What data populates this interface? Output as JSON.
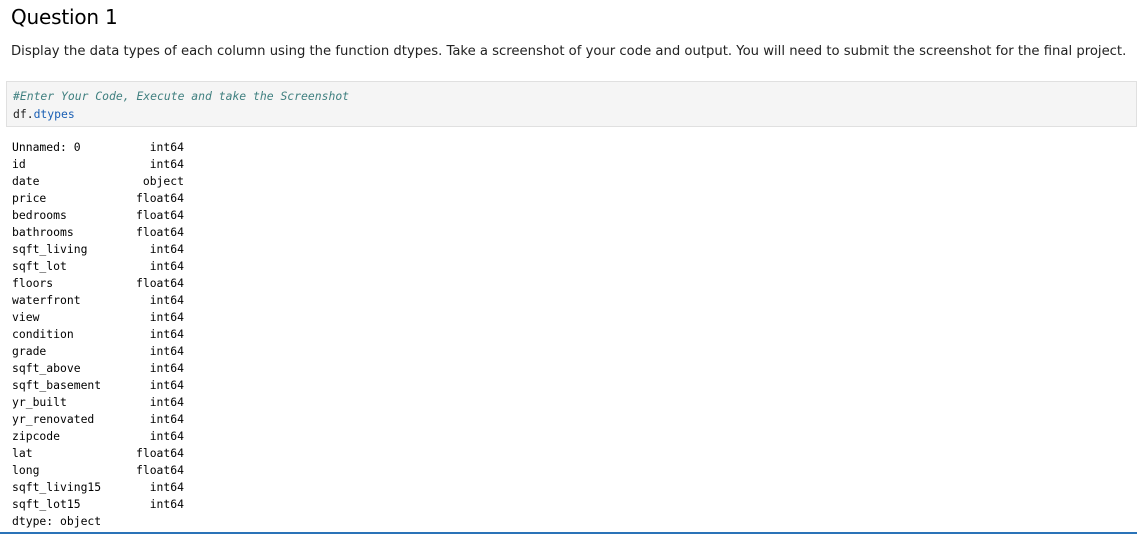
{
  "question": {
    "title": "Question 1",
    "description": "Display the data types of each column using the function dtypes. Take a screenshot of your code and output. You will need to submit the screenshot for the final project."
  },
  "code_cell": {
    "comment": "#Enter Your Code, Execute and take the Screenshot",
    "code_obj": "df.",
    "code_attr": "dtypes"
  },
  "output": {
    "rows": [
      {
        "name": "Unnamed: 0",
        "type": "int64"
      },
      {
        "name": "id",
        "type": "int64"
      },
      {
        "name": "date",
        "type": "object"
      },
      {
        "name": "price",
        "type": "float64"
      },
      {
        "name": "bedrooms",
        "type": "float64"
      },
      {
        "name": "bathrooms",
        "type": "float64"
      },
      {
        "name": "sqft_living",
        "type": "int64"
      },
      {
        "name": "sqft_lot",
        "type": "int64"
      },
      {
        "name": "floors",
        "type": "float64"
      },
      {
        "name": "waterfront",
        "type": "int64"
      },
      {
        "name": "view",
        "type": "int64"
      },
      {
        "name": "condition",
        "type": "int64"
      },
      {
        "name": "grade",
        "type": "int64"
      },
      {
        "name": "sqft_above",
        "type": "int64"
      },
      {
        "name": "sqft_basement",
        "type": "int64"
      },
      {
        "name": "yr_built",
        "type": "int64"
      },
      {
        "name": "yr_renovated",
        "type": "int64"
      },
      {
        "name": "zipcode",
        "type": "int64"
      },
      {
        "name": "lat",
        "type": "float64"
      },
      {
        "name": "long",
        "type": "float64"
      },
      {
        "name": "sqft_living15",
        "type": "int64"
      },
      {
        "name": "sqft_lot15",
        "type": "int64"
      }
    ],
    "dtype_footer": "dtype: object"
  }
}
